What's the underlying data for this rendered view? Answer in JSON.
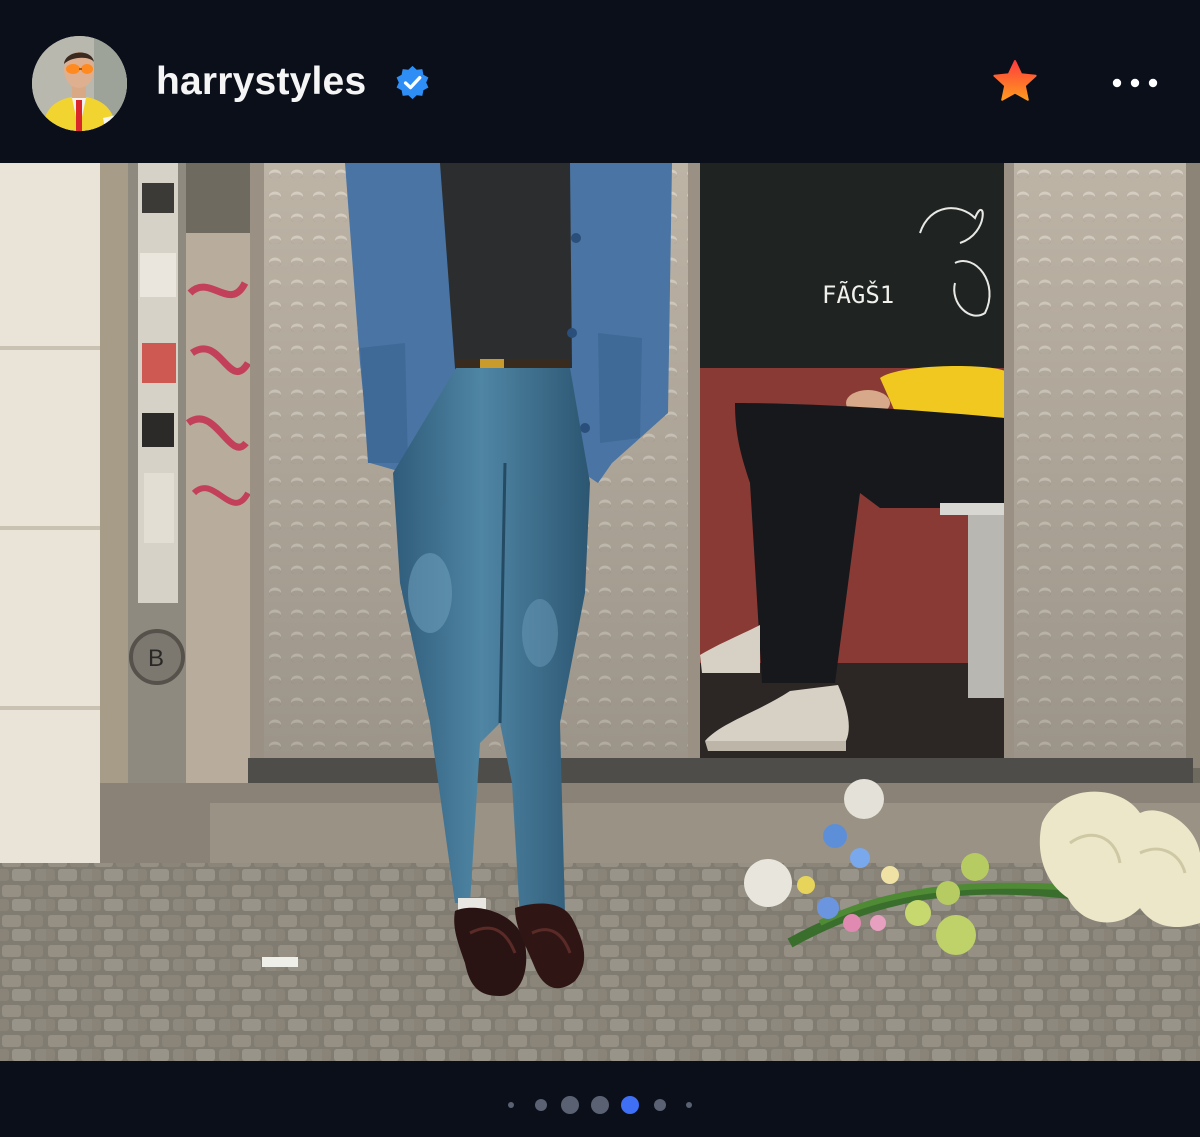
{
  "post": {
    "username": "harrystyles",
    "verified": true,
    "favorited": true,
    "colors": {
      "background": "#0b0f1a",
      "verified_badge": "#2f8ef5",
      "favorite_star_top": "#ff3d3d",
      "favorite_star_bottom": "#ff9a1f",
      "active_dot": "#3f6ff5",
      "inactive_dot": "#5a6172"
    },
    "icons": {
      "avatar": "avatar",
      "verified": "verified-badge-icon",
      "favorite": "star-icon",
      "more": "more-options-icon"
    }
  },
  "photo": {
    "graffiti_text": "FÃGŠ1"
  },
  "carousel": {
    "total_slides": 7,
    "active_index": 4
  }
}
